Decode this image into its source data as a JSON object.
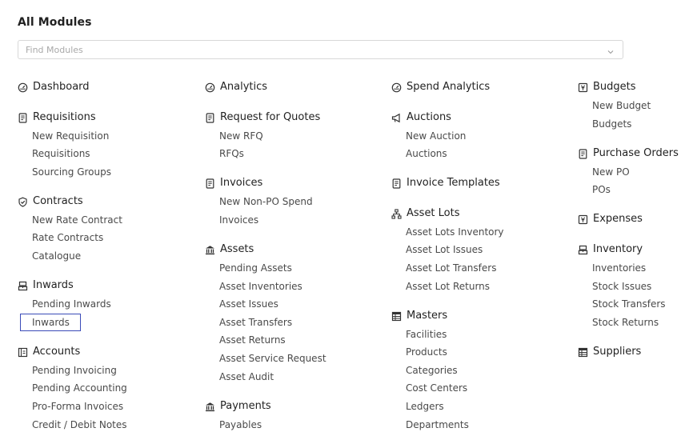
{
  "page": {
    "title": "All Modules",
    "search_placeholder": "Find Modules"
  },
  "columns": [
    {
      "sections": [
        {
          "icon": "gauge-icon",
          "label": "Dashboard",
          "items": []
        },
        {
          "icon": "document-icon",
          "label": "Requisitions",
          "items": [
            "New Requisition",
            "Requisitions",
            "Sourcing Groups"
          ]
        },
        {
          "icon": "shield-check-icon",
          "label": "Contracts",
          "items": [
            "New Rate Contract",
            "Rate Contracts",
            "Catalogue"
          ]
        },
        {
          "icon": "inwards-icon",
          "label": "Inwards",
          "items": [
            "Pending Inwards",
            "Inwards"
          ]
        },
        {
          "icon": "ledger-icon",
          "label": "Accounts",
          "items": [
            "Pending Invoicing",
            "Pending Accounting",
            "Pro-Forma Invoices",
            "Credit / Debit Notes"
          ]
        }
      ]
    },
    {
      "sections": [
        {
          "icon": "gauge-icon",
          "label": "Analytics",
          "items": []
        },
        {
          "icon": "document-icon",
          "label": "Request for Quotes",
          "items": [
            "New RFQ",
            "RFQs"
          ]
        },
        {
          "icon": "document-icon",
          "label": "Invoices",
          "items": [
            "New Non-PO Spend",
            "Invoices"
          ]
        },
        {
          "icon": "bank-icon",
          "label": "Assets",
          "items": [
            "Pending Assets",
            "Asset Inventories",
            "Asset Issues",
            "Asset Transfers",
            "Asset Returns",
            "Asset Service Request",
            "Asset Audit"
          ]
        },
        {
          "icon": "bank-icon",
          "label": "Payments",
          "items": [
            "Payables"
          ]
        }
      ]
    },
    {
      "sections": [
        {
          "icon": "gauge-icon",
          "label": "Spend Analytics",
          "items": []
        },
        {
          "icon": "megaphone-icon",
          "label": "Auctions",
          "items": [
            "New Auction",
            "Auctions"
          ]
        },
        {
          "icon": "document-icon",
          "label": "Invoice Templates",
          "items": []
        },
        {
          "icon": "sitemap-icon",
          "label": "Asset Lots",
          "items": [
            "Asset Lots Inventory",
            "Asset Lot Issues",
            "Asset Lot Transfers",
            "Asset Lot Returns"
          ]
        },
        {
          "icon": "table-icon",
          "label": "Masters",
          "items": [
            "Facilities",
            "Products",
            "Categories",
            "Cost Centers",
            "Ledgers",
            "Departments"
          ]
        }
      ]
    },
    {
      "sections": [
        {
          "icon": "currency-icon",
          "label": "Budgets",
          "items": [
            "New Budget",
            "Budgets"
          ]
        },
        {
          "icon": "document-icon",
          "label": "Purchase Orders",
          "items": [
            "New PO",
            "POs"
          ]
        },
        {
          "icon": "currency-icon",
          "label": "Expenses",
          "items": []
        },
        {
          "icon": "inwards-icon",
          "label": "Inventory",
          "items": [
            "Inventories",
            "Stock Issues",
            "Stock Transfers",
            "Stock Returns"
          ]
        },
        {
          "icon": "table-icon",
          "label": "Suppliers",
          "items": []
        }
      ]
    }
  ],
  "focused_item": "Inwards",
  "colors": {
    "focus_outline": "#3b4bb8",
    "link_text": "#4a4a4a",
    "header_text": "#222222"
  }
}
